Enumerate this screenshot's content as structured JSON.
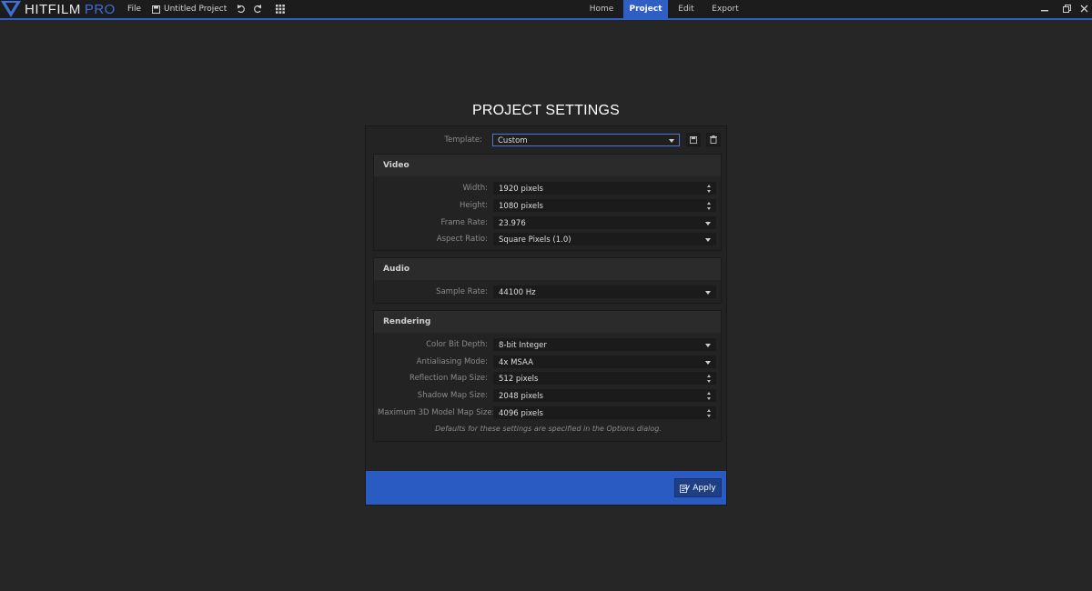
{
  "app": {
    "logo_name": "HITFILM",
    "logo_edition": "PRO"
  },
  "menu": {
    "file": "File",
    "project_name": "Untitled Project"
  },
  "nav": {
    "tabs": [
      "Home",
      "Project",
      "Edit",
      "Export"
    ],
    "active": "Project"
  },
  "dialog": {
    "title": "PROJECT SETTINGS",
    "template_label": "Template:",
    "template_value": "Custom",
    "video": {
      "heading": "Video",
      "width_label": "Width:",
      "width_value": "1920 pixels",
      "height_label": "Height:",
      "height_value": "1080 pixels",
      "frame_rate_label": "Frame Rate:",
      "frame_rate_value": "23.976",
      "aspect_label": "Aspect Ratio:",
      "aspect_value": "Square Pixels (1.0)"
    },
    "audio": {
      "heading": "Audio",
      "sample_rate_label": "Sample Rate:",
      "sample_rate_value": "44100 Hz"
    },
    "rendering": {
      "heading": "Rendering",
      "color_depth_label": "Color Bit Depth:",
      "color_depth_value": "8-bit Integer",
      "aa_label": "Antialiasing Mode:",
      "aa_value": "4x MSAA",
      "reflection_label": "Reflection Map Size:",
      "reflection_value": "512 pixels",
      "shadow_label": "Shadow Map Size:",
      "shadow_value": "2048 pixels",
      "max3d_label": "Maximum 3D Model Map Size:",
      "max3d_value": "4096 pixels",
      "hint": "Defaults for these settings are specified in the Options dialog."
    },
    "apply_label": "Apply"
  },
  "colors": {
    "accent": "#2f5fc4",
    "background": "#262626",
    "apply_bar": "#2a5bc2"
  }
}
